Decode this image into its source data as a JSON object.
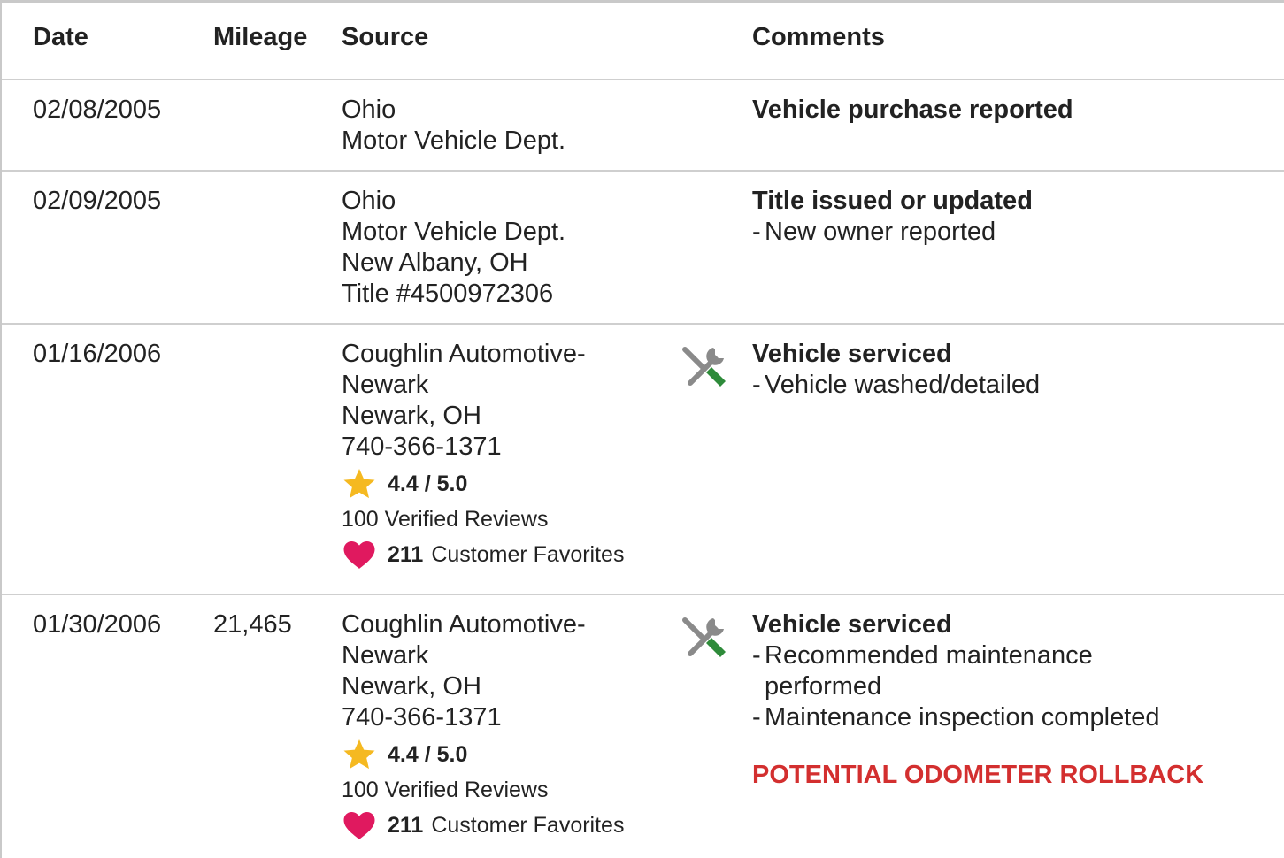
{
  "headers": {
    "date": "Date",
    "mileage": "Mileage",
    "source": "Source",
    "comments": "Comments"
  },
  "rows": [
    {
      "date": "02/08/2005",
      "mileage": "",
      "source": [
        "Ohio",
        "Motor Vehicle Dept."
      ],
      "comment_title": "Vehicle purchase reported",
      "comment_items": []
    },
    {
      "date": "02/09/2005",
      "mileage": "",
      "source": [
        "Ohio",
        "Motor Vehicle Dept.",
        "New Albany, OH",
        "Title #4500972306"
      ],
      "comment_title": "Title issued or updated",
      "comment_items": [
        "New owner reported"
      ]
    },
    {
      "date": "01/16/2006",
      "mileage": "",
      "icon": "service-tools-icon",
      "source": [
        "Coughlin Automotive-",
        "Newark",
        "Newark, OH",
        "740-366-1371"
      ],
      "rating": "4.4 / 5.0",
      "reviews": "100 Verified Reviews",
      "favorites_count": "211",
      "favorites_label": "Customer Favorites",
      "comment_title": "Vehicle serviced",
      "comment_items": [
        "Vehicle washed/detailed"
      ]
    },
    {
      "date": "01/30/2006",
      "mileage": "21,465",
      "icon": "service-tools-icon",
      "source": [
        "Coughlin Automotive-",
        "Newark",
        "Newark, OH",
        "740-366-1371"
      ],
      "rating": "4.4 / 5.0",
      "reviews": "100 Verified Reviews",
      "favorites_count": "211",
      "favorites_label": "Customer Favorites",
      "comment_title": "Vehicle serviced",
      "comment_items": [
        "Recommended maintenance",
        "performed",
        "Maintenance inspection completed"
      ],
      "alert": "POTENTIAL ODOMETER ROLLBACK"
    }
  ],
  "colors": {
    "star": "#f5b921",
    "heart": "#e0195f",
    "alert": "#d32f2f",
    "tool_gray": "#8a8a8a",
    "tool_green": "#2e8b3a"
  }
}
